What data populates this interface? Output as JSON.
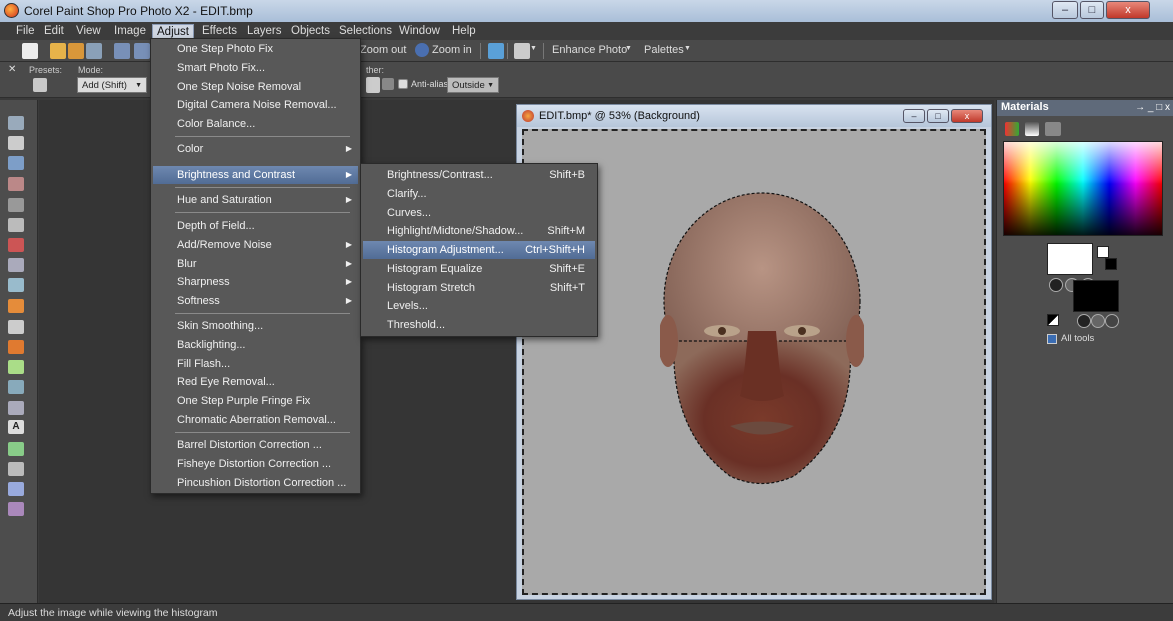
{
  "window": {
    "title": "Corel Paint Shop Pro Photo X2 - EDIT.bmp",
    "btn_min": "–",
    "btn_max": "□",
    "btn_close": "x"
  },
  "menubar": [
    "File",
    "Edit",
    "View",
    "Image",
    "Adjust",
    "Effects",
    "Layers",
    "Objects",
    "Selections",
    "Window",
    "Help"
  ],
  "toolbar1": {
    "zoom_out": "Zoom out",
    "zoom_in": "Zoom in",
    "enhance_photo": "Enhance Photo",
    "palettes": "Palettes"
  },
  "toolbar2": {
    "presets_label": "Presets:",
    "mode_label": "Mode:",
    "mode_value": "Add (Shift)",
    "feather_label": "ther:",
    "antialias_label": "Anti-alias",
    "antialias_value": "Outside"
  },
  "adjust_menu": {
    "items": [
      {
        "label": "One Step Photo Fix",
        "submenu": false
      },
      {
        "label": "Smart Photo Fix...",
        "submenu": false
      },
      {
        "label": "One Step Noise Removal",
        "submenu": false
      },
      {
        "label": "Digital Camera Noise Removal...",
        "submenu": false
      },
      {
        "label": "Color Balance...",
        "submenu": false
      },
      {
        "label": "Color",
        "submenu": true
      },
      {
        "label": "Brightness and Contrast",
        "submenu": true
      },
      {
        "label": "Hue and Saturation",
        "submenu": true
      },
      {
        "label": "Depth of Field...",
        "submenu": false
      },
      {
        "label": "Add/Remove Noise",
        "submenu": true
      },
      {
        "label": "Blur",
        "submenu": true
      },
      {
        "label": "Sharpness",
        "submenu": true
      },
      {
        "label": "Softness",
        "submenu": true
      },
      {
        "label": "Skin Smoothing...",
        "submenu": false
      },
      {
        "label": "Backlighting...",
        "submenu": false
      },
      {
        "label": "Fill Flash...",
        "submenu": false
      },
      {
        "label": "Red Eye Removal...",
        "submenu": false
      },
      {
        "label": "One Step Purple Fringe Fix",
        "submenu": false
      },
      {
        "label": "Chromatic Aberration Removal...",
        "submenu": false
      },
      {
        "label": "Barrel Distortion Correction ...",
        "submenu": false
      },
      {
        "label": "Fisheye Distortion Correction ...",
        "submenu": false
      },
      {
        "label": "Pincushion Distortion Correction ...",
        "submenu": false
      }
    ]
  },
  "brightness_submenu": {
    "items": [
      {
        "label": "Brightness/Contrast...",
        "shortcut": "Shift+B"
      },
      {
        "label": "Clarify...",
        "shortcut": ""
      },
      {
        "label": "Curves...",
        "shortcut": ""
      },
      {
        "label": "Highlight/Midtone/Shadow...",
        "shortcut": "Shift+M"
      },
      {
        "label": "Histogram Adjustment...",
        "shortcut": "Ctrl+Shift+H"
      },
      {
        "label": "Histogram Equalize",
        "shortcut": "Shift+E"
      },
      {
        "label": "Histogram Stretch",
        "shortcut": "Shift+T"
      },
      {
        "label": "Levels...",
        "shortcut": ""
      },
      {
        "label": "Threshold...",
        "shortcut": ""
      }
    ]
  },
  "image_window": {
    "title": "EDIT.bmp* @  53% (Background)"
  },
  "materials": {
    "title": "Materials",
    "controls": "→ _ □ x",
    "all_tools": "All tools"
  },
  "status": {
    "text": "Adjust the image while viewing the histogram"
  }
}
